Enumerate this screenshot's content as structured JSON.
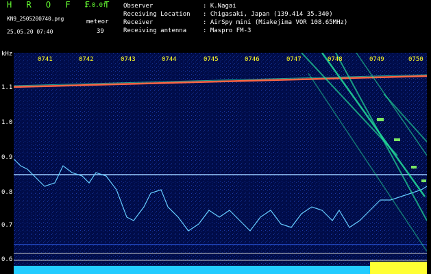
{
  "header": {
    "logo": "H R O F F T",
    "version": "1.0.0f",
    "filename": "KN9_2505200740.png",
    "meteor_label": "meteor",
    "datetime": "25.05.20 07:40",
    "meteor_count": "39",
    "info": [
      {
        "label": "Observer",
        "value": ": K.Nagai"
      },
      {
        "label": "Receiving Location",
        "value": ": Chigasaki, Japan (139.414 35.340)"
      },
      {
        "label": "Receiver",
        "value": ": AirSpy mini (Miakejima VOR 108.65MHz)"
      },
      {
        "label": "Receiving antenna",
        "value": ": Maspro FM-3"
      }
    ]
  },
  "axis": {
    "y_unit": "kHz",
    "y_ticks": [
      "1.1",
      "1.0",
      "0.9",
      "0.8",
      "0.7",
      "0.6"
    ],
    "x_ticks": [
      "0741",
      "0742",
      "0743",
      "0744",
      "0745",
      "0746",
      "0747",
      "0748",
      "0749",
      "0750"
    ]
  },
  "colors": {
    "background": "#000c49",
    "carrier": "#ff6644",
    "tick_label": "#ffff22",
    "logo": "#66ff33"
  }
}
